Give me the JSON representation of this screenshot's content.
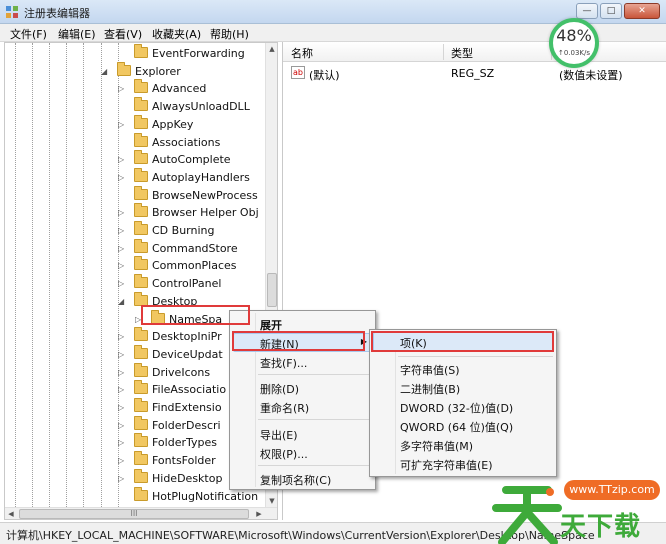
{
  "window": {
    "title": "注册表编辑器",
    "buttons": [
      "—",
      "□",
      "✕"
    ]
  },
  "menu": [
    "文件(F)",
    "编辑(E)",
    "查看(V)",
    "收藏夹(A)",
    "帮助(H)"
  ],
  "tree": {
    "items": [
      {
        "label": "EventForwarding",
        "expander": "",
        "level": 2
      },
      {
        "label": "Explorer",
        "expander": "◢",
        "level": 1
      },
      {
        "label": "Advanced",
        "expander": "▷",
        "level": 2
      },
      {
        "label": "AlwaysUnloadDLL",
        "expander": "",
        "level": 2
      },
      {
        "label": "AppKey",
        "expander": "▷",
        "level": 2
      },
      {
        "label": "Associations",
        "expander": "",
        "level": 2
      },
      {
        "label": "AutoComplete",
        "expander": "▷",
        "level": 2
      },
      {
        "label": "AutoplayHandlers",
        "expander": "▷",
        "level": 2
      },
      {
        "label": "BrowseNewProcess",
        "expander": "",
        "level": 2
      },
      {
        "label": "Browser Helper Obj",
        "expander": "▷",
        "level": 2
      },
      {
        "label": "CD Burning",
        "expander": "▷",
        "level": 2
      },
      {
        "label": "CommandStore",
        "expander": "▷",
        "level": 2
      },
      {
        "label": "CommonPlaces",
        "expander": "▷",
        "level": 2
      },
      {
        "label": "ControlPanel",
        "expander": "▷",
        "level": 2
      },
      {
        "label": "Desktop",
        "expander": "◢",
        "level": 2
      },
      {
        "label": "NameSpa",
        "expander": "▷",
        "level": 3
      },
      {
        "label": "DesktopIniPr",
        "expander": "▷",
        "level": 2
      },
      {
        "label": "DeviceUpdat",
        "expander": "▷",
        "level": 2
      },
      {
        "label": "DriveIcons",
        "expander": "▷",
        "level": 2
      },
      {
        "label": "FileAssociatio",
        "expander": "▷",
        "level": 2
      },
      {
        "label": "FindExtensio",
        "expander": "▷",
        "level": 2
      },
      {
        "label": "FolderDescri",
        "expander": "▷",
        "level": 2
      },
      {
        "label": "FolderTypes",
        "expander": "▷",
        "level": 2
      },
      {
        "label": "FontsFolder",
        "expander": "▷",
        "level": 2
      },
      {
        "label": "HideDesktop",
        "expander": "▷",
        "level": 2
      },
      {
        "label": "HotPlugNotification",
        "expander": "",
        "level": 2
      }
    ],
    "hscroll_thumb": "III"
  },
  "values": {
    "headers": [
      "名称",
      "类型",
      "数据"
    ],
    "rows": [
      {
        "name": "(默认)",
        "type": "REG_SZ",
        "data": "(数值未设置)"
      }
    ],
    "icon_text": "ab"
  },
  "speed": {
    "percent": "48%",
    "rate": "↑0.03K/s",
    "color": "#43c06a"
  },
  "context_menu": {
    "items": [
      {
        "label": "展开",
        "bold": true
      },
      {
        "label": "新建(N)",
        "submenu": true
      },
      {
        "label": "查找(F)..."
      },
      {
        "label": "删除(D)"
      },
      {
        "label": "重命名(R)"
      },
      {
        "label": "导出(E)"
      },
      {
        "label": "权限(P)..."
      },
      {
        "label": "复制项名称(C)"
      }
    ]
  },
  "submenu": {
    "items": [
      "项(K)",
      "字符串值(S)",
      "二进制值(B)",
      "DWORD (32-位)值(D)",
      "QWORD (64 位)值(Q)",
      "多字符串值(M)",
      "可扩充字符串值(E)"
    ]
  },
  "status": "计算机\\HKEY_LOCAL_MACHINE\\SOFTWARE\\Microsoft\\Windows\\CurrentVersion\\Explorer\\Desktop\\NameSpace",
  "watermark": {
    "url": "www.TTzip.com",
    "text": "天下载"
  },
  "colors": {
    "highlight_box": "#e03a3a",
    "folder": "#f1c761",
    "watermark_orange": "#ef6c26",
    "watermark_green": "#3eaa3a"
  }
}
